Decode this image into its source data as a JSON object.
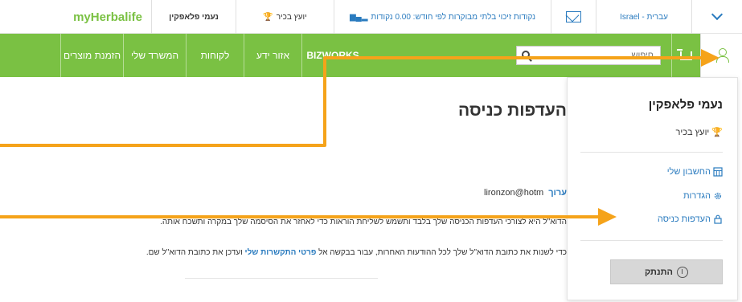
{
  "topbar": {
    "brand": "myHerbalife",
    "user_name": "נעמי פלאפקין",
    "advisor": "יועץ בכיר",
    "points": "נקודות זיכוי בלתי מבוקרות לפי חודש: 0.00 נקודות",
    "language": "עברית - Israel"
  },
  "nav": {
    "orders": "הזמנת מוצרים",
    "office": "המשרד שלי",
    "customers": "לקוחות",
    "knowledge": "אזור ידע",
    "bizworks": "BIZWORKS",
    "search_placeholder": "חיפוש"
  },
  "main": {
    "title": "העדפות כניסה",
    "edit_link": "ערוך",
    "email": "lironzon@hotm",
    "line1": "הדוא\"ל היא לצורכי העדפות הכניסה שלך בלבד ותשמש לשליחת הוראות כדי לאחזר את הסיסמה שלך במקרה ותשכח אותה.",
    "line2_prefix": "כדי לשנות את כתובת הדוא\"ל שלך לכל ההודעות האחרות, עבור בבקשה אל",
    "line2_link": "פרטי התקשרות שלי",
    "line2_suffix": "ועדכן את כתובת הדוא\"ל שם."
  },
  "dropdown": {
    "name": "נעמי פלאפקין",
    "role": "יועץ בכיר",
    "links": [
      "החשבון שלי",
      "הגדרות",
      "העדפות כניסה"
    ],
    "logout": "התנתק"
  },
  "colors": {
    "brand_green": "#7ac143",
    "link_blue": "#2a7bbf",
    "arrow_orange": "#f5a31a"
  }
}
